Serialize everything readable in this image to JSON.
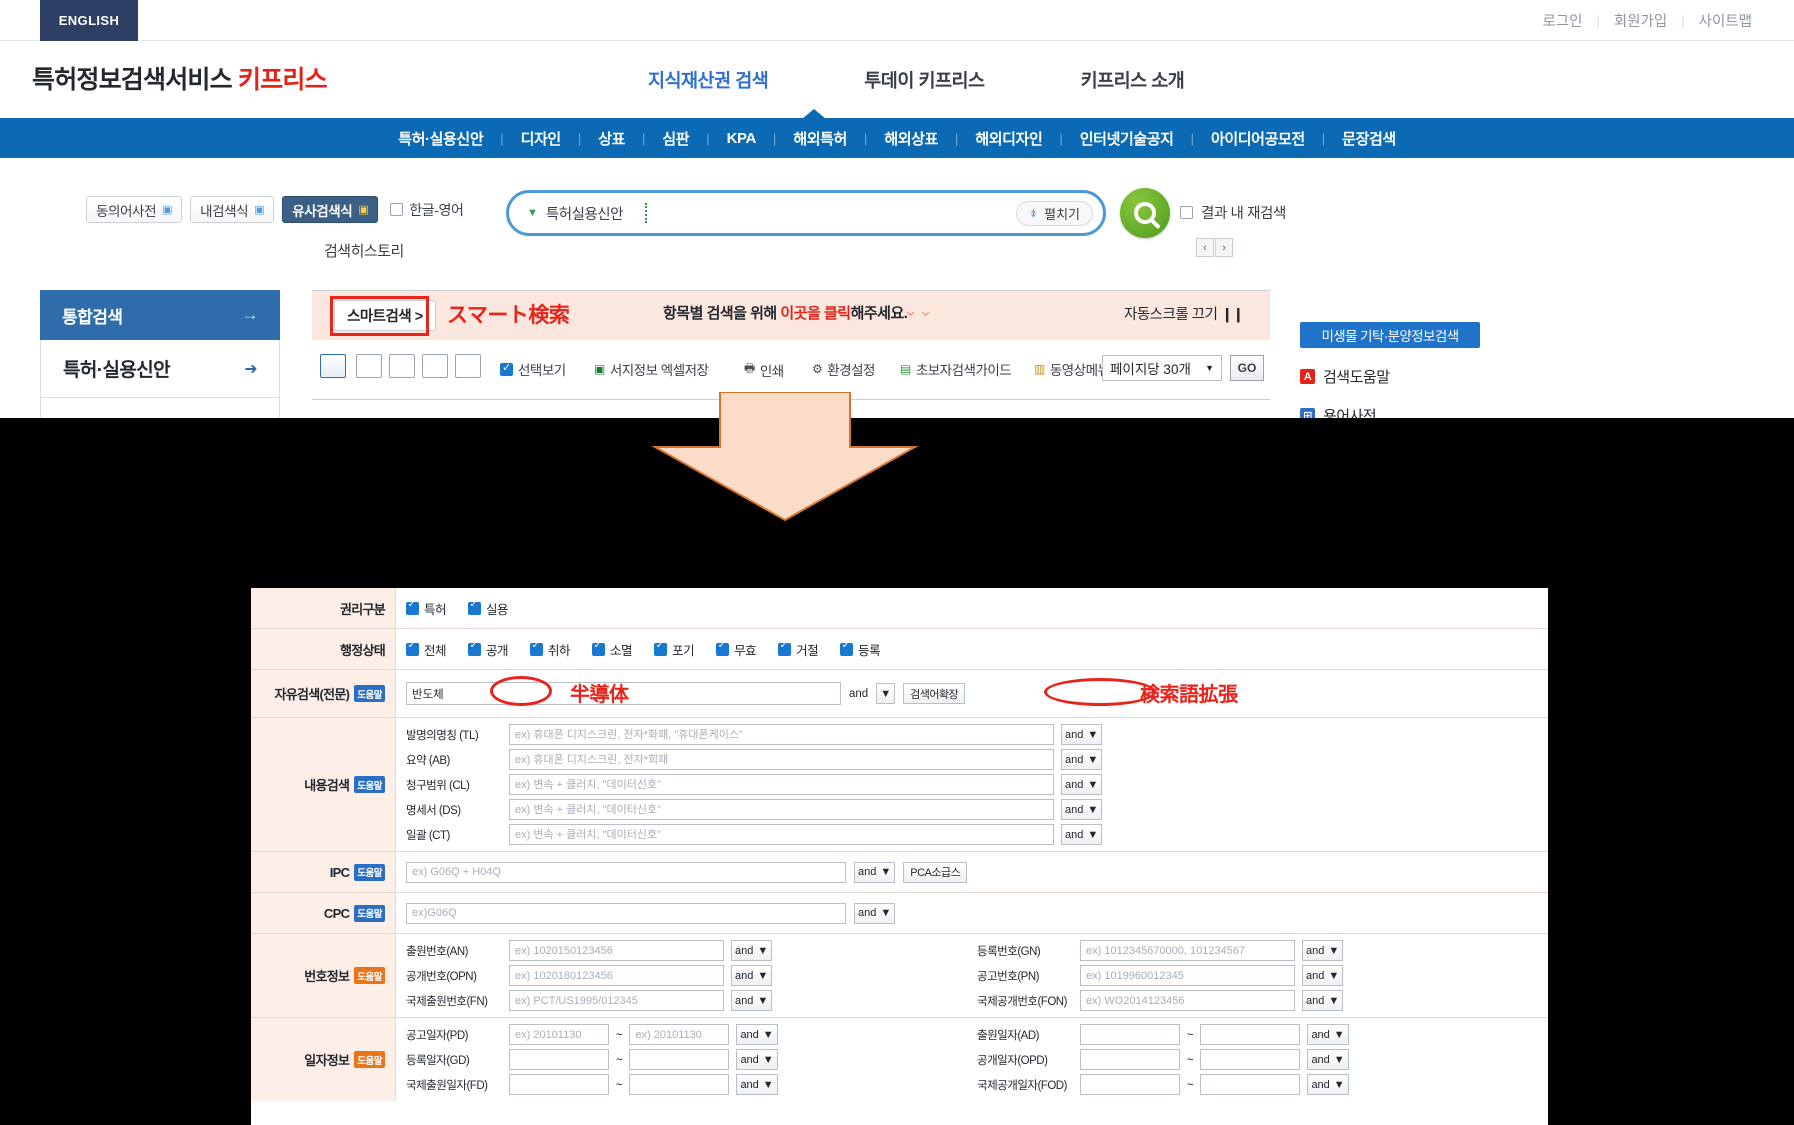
{
  "utility": {
    "english_tab": "ENGLISH",
    "links": [
      "로그인",
      "회원가입",
      "사이트맵"
    ],
    "separator": "|"
  },
  "brand": {
    "prefix": "특허정보검색서비스",
    "name": "키프리스"
  },
  "global_nav": [
    {
      "label": "지식재산권 검색",
      "active": true
    },
    {
      "label": "투데이 키프리스",
      "active": false
    },
    {
      "label": "키프리스 소개",
      "active": false
    }
  ],
  "blue_menu": {
    "separator": "|",
    "items": [
      "특허·실용신안",
      "디자인",
      "상표",
      "심판",
      "KPA",
      "해외특허",
      "해외상표",
      "해외디자인",
      "인터넷기술공지",
      "아이디어공모전",
      "문장검색"
    ]
  },
  "search_toolbar": {
    "buttons": [
      {
        "label": "동의어사전",
        "icon": "external-link-icon",
        "active": false
      },
      {
        "label": "내검색식",
        "icon": "external-link-icon",
        "active": false
      },
      {
        "label": "유사검색식",
        "icon": "external-link-icon",
        "active": true
      }
    ],
    "korean_english_label": "한글-영어",
    "korean_english_checked": false
  },
  "searchbox": {
    "type_label": "특허실용신안",
    "caret": "▼",
    "value": "",
    "placeholder": "",
    "expand_label": "펼치기",
    "expand_icon": "expand-down-icon"
  },
  "search_button": {
    "icon": "magnifier-icon"
  },
  "research": {
    "label": "결과 내 재검색",
    "checked": false
  },
  "history": {
    "label": "검색히스토리"
  },
  "pager": {
    "prev": "‹",
    "next": "›"
  },
  "sidebar": {
    "items": [
      {
        "label": "통합검색",
        "arrow": "→",
        "active": true
      },
      {
        "label": "특허·실용신안",
        "arrow": "➜",
        "active": false
      }
    ]
  },
  "smart_bar": {
    "smart_button": "스마트검색 >",
    "jp_annotation": "スマート検索",
    "message_prefix": "항목별 검색을 위해 ",
    "message_highlight": "이곳을 클릭",
    "message_suffix": "해주세요.",
    "chevron_icon": "double-chevron-down-icon",
    "autoscroll_label": "자동스크롤 끄기",
    "autoscroll_icon": "pause-icon"
  },
  "results_toolbar": {
    "view_icons": [
      "list-view-icon",
      "detail-view-icon",
      "text-view-icon",
      "thumb-view-icon",
      "grid-view-icon"
    ],
    "options": [
      {
        "label": "선택보기",
        "icon": "checkbox-icon",
        "checked": true
      },
      {
        "label": "서지정보 엑셀저장",
        "icon": "excel-icon"
      },
      {
        "label": "인쇄",
        "icon": "printer-icon"
      },
      {
        "label": "환경설정",
        "icon": "gear-icon"
      },
      {
        "label": "초보자검색가이드",
        "icon": "guide-icon"
      },
      {
        "label": "동영상메뉴얼",
        "icon": "video-icon"
      }
    ],
    "per_page": "페이지당 30개",
    "per_page_caret": "▼",
    "go_label": "GO"
  },
  "right_column": {
    "micro_button": "미생물 기탁·분양정보검색",
    "items": [
      {
        "label": "검색도움말",
        "icon": "help-icon",
        "color": "#e2231a"
      },
      {
        "label": "용어사전",
        "icon": "dictionary-icon",
        "color": "#2b6fc4"
      }
    ]
  },
  "form": {
    "rows": {
      "rights_type": {
        "label": "권리구분",
        "options": [
          {
            "label": "특허",
            "checked": true
          },
          {
            "label": "실용",
            "checked": true
          }
        ]
      },
      "admin_status": {
        "label": "행정상태",
        "options": [
          {
            "label": "전체",
            "checked": true
          },
          {
            "label": "공개",
            "checked": true
          },
          {
            "label": "취하",
            "checked": true
          },
          {
            "label": "소멸",
            "checked": true
          },
          {
            "label": "포기",
            "checked": true
          },
          {
            "label": "무효",
            "checked": true
          },
          {
            "label": "거절",
            "checked": true
          },
          {
            "label": "등록",
            "checked": true
          }
        ]
      },
      "free_search": {
        "label": "자유검색(전문)",
        "help_chip": "도움말",
        "value": "반도체",
        "operator": "and",
        "expand_btn": "검색어확장",
        "jp_value": "半導体",
        "jp_expand": "検索語拡張"
      },
      "content_search": {
        "label": "내용검색",
        "help_chip": "도움말",
        "fields": [
          {
            "label": "발명의명칭 (TL)",
            "placeholder": "ex) 휴대폰 디지스크린, 전자*화패, \"휴대폰케이스\"",
            "operator": "and"
          },
          {
            "label": "요약 (AB)",
            "placeholder": "ex) 휴대폰 디지스크린, 전자*회패",
            "operator": "and"
          },
          {
            "label": "청구범위 (CL)",
            "placeholder": "ex) 변속 + 클러치, \"데이터신호\"",
            "operator": "and"
          },
          {
            "label": "명세서 (DS)",
            "placeholder": "ex) 변속 + 클러치, \"데이터신호\"",
            "operator": "and"
          },
          {
            "label": "일괄 (CT)",
            "placeholder": "ex) 변속 + 클러치, \"데이터신호\"",
            "operator": "and"
          }
        ]
      },
      "ipc": {
        "label": "IPC",
        "help_chip": "도움말",
        "placeholder": "ex) G06Q + H04Q",
        "operator": "and",
        "side_button": "PCA소급스"
      },
      "cpc": {
        "label": "CPC",
        "help_chip": "도움말",
        "placeholder": "ex)G06Q",
        "operator": "and"
      },
      "number_info": {
        "label": "번호정보",
        "help_chip": "도움말",
        "left_fields": [
          {
            "label": "출원번호(AN)",
            "placeholder": "ex) 1020150123456",
            "operator": "and"
          },
          {
            "label": "공개번호(OPN)",
            "placeholder": "ex) 1020180123456",
            "operator": "and"
          },
          {
            "label": "국제출원번호(FN)",
            "placeholder": "ex) PCT/US1995/012345",
            "operator": "and"
          }
        ],
        "right_fields": [
          {
            "label": "등록번호(GN)",
            "placeholder": "ex) 1012345670000, 101234567",
            "operator": "and"
          },
          {
            "label": "공고번호(PN)",
            "placeholder": "ex) 1019960012345",
            "operator": "and"
          },
          {
            "label": "국제공개번호(FON)",
            "placeholder": "ex) WO2014123456",
            "operator": "and"
          }
        ]
      },
      "date_info": {
        "label": "일자정보",
        "help_chip": "도움말",
        "left_fields": [
          {
            "label": "공고일자(PD)",
            "from": "ex) 20101130",
            "to": "ex) 20101130",
            "operator": "and"
          },
          {
            "label": "등록일자(GD)",
            "from": "",
            "to": "",
            "operator": "and"
          },
          {
            "label": "국제출원일자(FD)",
            "from": "",
            "to": "",
            "operator": "and"
          }
        ],
        "right_fields": [
          {
            "label": "출원일자(AD)",
            "from": "",
            "to": "",
            "operator": "and"
          },
          {
            "label": "공개일자(OPD)",
            "from": "",
            "to": "",
            "operator": "and"
          },
          {
            "label": "국제공개일자(FOD)",
            "from": "",
            "to": "",
            "operator": "and"
          }
        ],
        "range_sep": "~"
      }
    }
  },
  "colors": {
    "brand_red": "#e2231a",
    "nav_blue": "#0c6ab5",
    "accent_blue": "#2f6fd0",
    "annotation_red": "#e8241b",
    "pink_bar": "#fbe7dd",
    "search_green": "#4c9c1b"
  }
}
